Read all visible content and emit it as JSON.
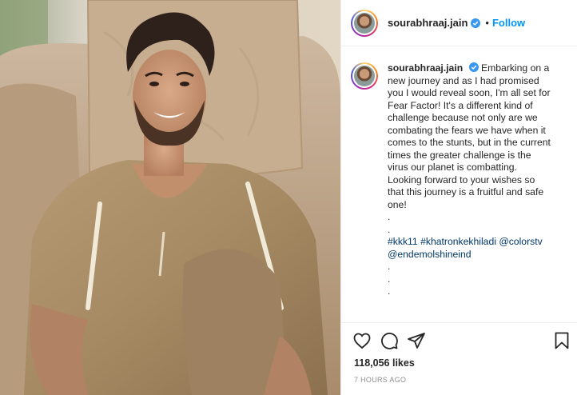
{
  "post": {
    "username": "sourabhraaj.jain",
    "verified": true,
    "follow_label": "Follow",
    "separator": "•",
    "caption_lines": [
      "Embarking on a",
      "new journey and as I had promised",
      "you I would reveal soon, I'm all set for",
      "Fear Factor! It's a different kind of",
      "challenge because not only are we",
      "combating the fears we have when it",
      "comes to the stunts, but in the current",
      "times the greater challenge is the",
      "virus our planet is combatting.",
      "Looking forward to your wishes so",
      "that this journey is a fruitful and safe",
      "one!",
      ".",
      "."
    ],
    "hashtag_line_1": "#kkk11 #khatronkekhiladi @colorstv",
    "hashtag_line_2": "@endemolshineind",
    "trailing_dots": [
      ".",
      ".",
      "."
    ],
    "likes": "118,056 likes",
    "timestamp": "7 HOURS AGO"
  },
  "icons": {
    "like": "heart-icon",
    "comment": "comment-icon",
    "share": "share-icon",
    "save": "bookmark-icon",
    "verified": "verified-badge-icon"
  },
  "colors": {
    "follow": "#0095f6",
    "verified": "#3897f0",
    "hashtag": "#00376b",
    "muted": "#8e8e8e",
    "text": "#262626"
  }
}
